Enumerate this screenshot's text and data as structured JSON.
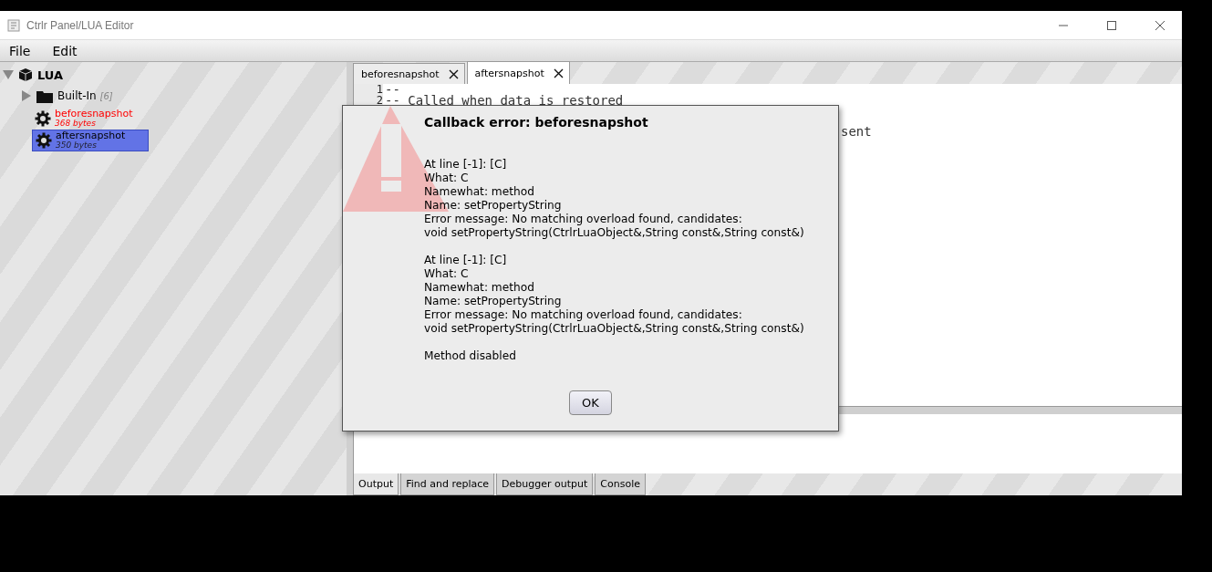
{
  "window": {
    "title": "Ctrlr Panel/LUA Editor"
  },
  "menu": [
    "File",
    "Edit"
  ],
  "tree": {
    "label": "LUA",
    "expanded": true,
    "children": [
      {
        "kind": "folder",
        "label": "Built-In",
        "count": "[6]",
        "expanded": false,
        "selected": false
      },
      {
        "kind": "method",
        "label": "beforesnapshot",
        "size": "368 bytes",
        "error": true,
        "selected": false
      },
      {
        "kind": "method",
        "label": "aftersnapshot",
        "size": "350 bytes",
        "error": false,
        "selected": true
      }
    ]
  },
  "editor_tabs": [
    {
      "label": "beforesnapshot",
      "selected": false
    },
    {
      "label": "aftersnapshot",
      "selected": true
    }
  ],
  "editor": {
    "lines": [
      {
        "number": "1",
        "text": "--"
      },
      {
        "number": "2",
        "text": "-- Called when data is restored"
      }
    ],
    "fragment": "sent"
  },
  "output_tabs": [
    {
      "label": "Output",
      "selected": true
    },
    {
      "label": "Find and replace",
      "selected": false
    },
    {
      "label": "Debugger output",
      "selected": false
    },
    {
      "label": "Console",
      "selected": false
    }
  ],
  "dialog": {
    "title": "Callback error: beforesnapshot",
    "paragraphs": [
      [
        "At line [-1]: [C]",
        "What: C",
        "Namewhat: method",
        "Name: setPropertyString",
        "Error message: No matching overload found, candidates:",
        "void setPropertyString(CtrlrLuaObject&,String const&,String const&)"
      ],
      [
        "At line [-1]: [C]",
        "What: C",
        "Namewhat: method",
        "Name: setPropertyString",
        "Error message: No matching overload found, candidates:",
        "void setPropertyString(CtrlrLuaObject&,String const&,String const&)"
      ],
      [
        "Method disabled"
      ]
    ],
    "button": "OK"
  }
}
